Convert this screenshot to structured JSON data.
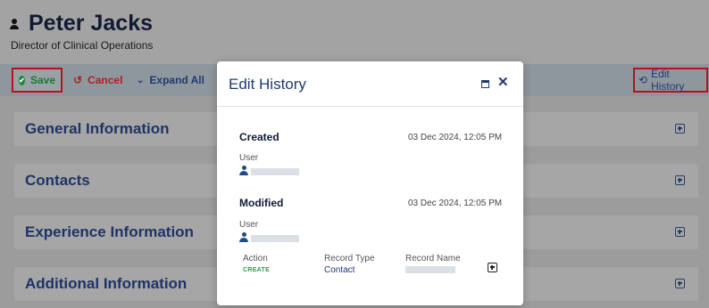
{
  "header": {
    "name": "Peter Jacks",
    "subtitle": "Director of Clinical Operations",
    "icon": "person-icon"
  },
  "toolbar": {
    "save_label": "Save",
    "cancel_label": "Cancel",
    "expand_label": "Expand All",
    "history_label": "Edit History",
    "icons": [
      "check-circle-icon",
      "undo-icon",
      "double-chevron-down-icon",
      "history-icon"
    ]
  },
  "sections": [
    {
      "title": "General Information"
    },
    {
      "title": "Contacts"
    },
    {
      "title": "Experience Information"
    },
    {
      "title": "Additional Information"
    }
  ],
  "modal": {
    "title": "Edit History",
    "created": {
      "label": "Created",
      "date": "03 Dec 2024, 12:05 PM",
      "user_label": "User"
    },
    "modified": {
      "label": "Modified",
      "date": "03 Dec 2024, 12:05 PM",
      "user_label": "User",
      "columns": {
        "action": "Action",
        "record_type": "Record Type",
        "record_name": "Record Name"
      },
      "values": {
        "action": "CREATE",
        "record_type": "Contact"
      }
    }
  },
  "colors": {
    "accent": "#1e3a73",
    "save": "#1a7a2e",
    "cancel": "#b02020",
    "highlight_border": "#b3121f",
    "create": "#22a04a"
  }
}
